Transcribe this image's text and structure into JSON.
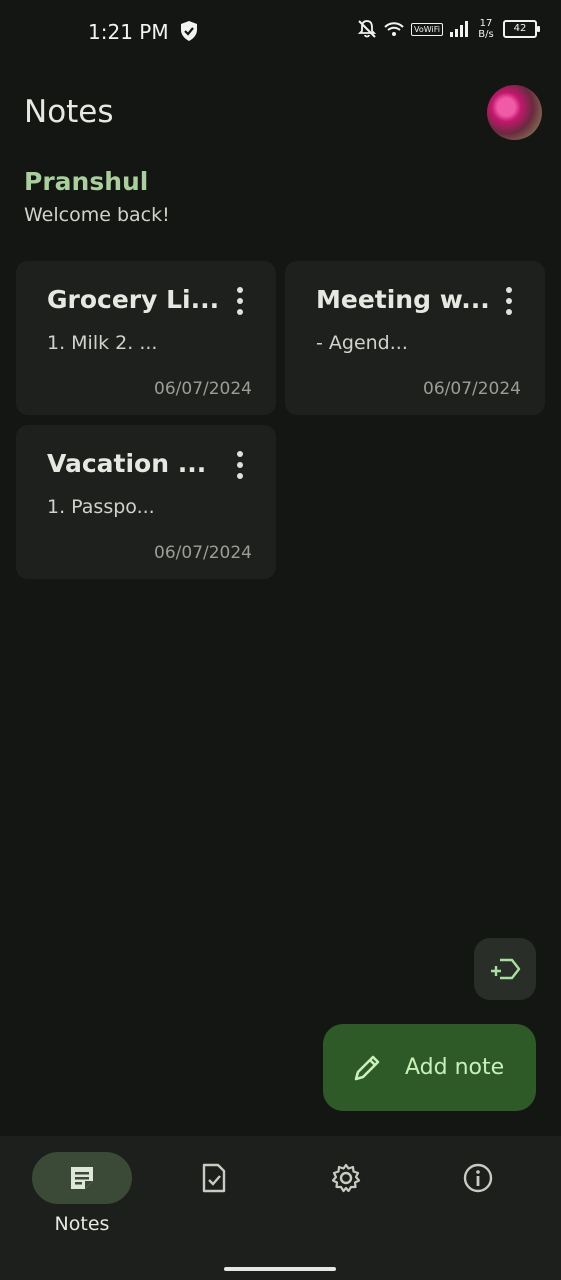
{
  "status_bar": {
    "time": "1:21 PM",
    "net_speed_value": "17",
    "net_speed_unit": "B/s",
    "vowifi": "VoWiFi",
    "battery": "42"
  },
  "header": {
    "title": "Notes",
    "username": "Pranshul",
    "welcome": "Welcome back!"
  },
  "notes": [
    {
      "title": "Grocery Li...",
      "preview": "1. Milk 2. ...",
      "date": "06/07/2024"
    },
    {
      "title": "Meeting w...",
      "preview": "- Agend...",
      "date": "06/07/2024"
    },
    {
      "title": "Vacation ...",
      "preview": "1. Passpo...",
      "date": "06/07/2024"
    }
  ],
  "fab": {
    "label": "Add note"
  },
  "bottom_nav": {
    "items": [
      {
        "label": "Notes",
        "icon": "notes-icon",
        "active": true
      },
      {
        "label": "",
        "icon": "checklist-icon",
        "active": false
      },
      {
        "label": "",
        "icon": "gear-icon",
        "active": false
      },
      {
        "label": "",
        "icon": "info-icon",
        "active": false
      }
    ]
  },
  "colors": {
    "background": "#141613",
    "card": "#1d201c",
    "accent_text": "#a9cf9c",
    "fab": "#2d5a27",
    "nav_active": "#3a4a36"
  }
}
